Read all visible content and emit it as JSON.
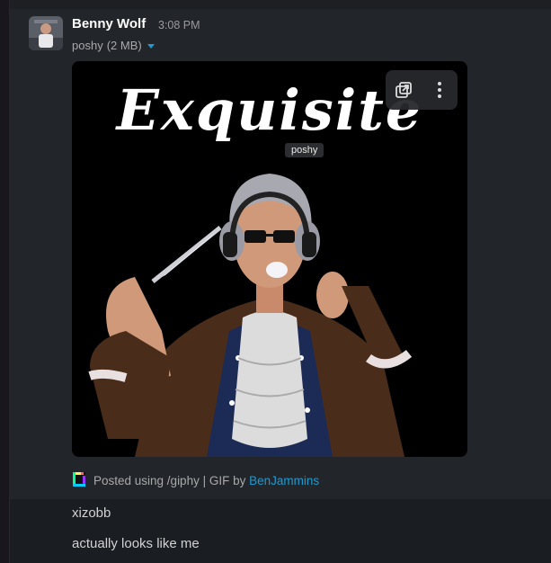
{
  "message": {
    "author": "Benny Wolf",
    "timestamp": "3:08 PM",
    "file_name": "poshy",
    "file_size": "(2 MB)",
    "gif": {
      "title": "Exquisite",
      "hover_tooltip": "poshy"
    },
    "attribution": {
      "prefix": "Posted using /giphy | GIF by ",
      "author_link": "BenJammins"
    }
  },
  "followups": [
    "xizobb",
    "actually looks like me"
  ],
  "colors": {
    "background": "#1a1d21",
    "highlight": "#222529",
    "link": "#1d9bd1",
    "author": "#ffffff",
    "muted": "#a9a9ab"
  }
}
